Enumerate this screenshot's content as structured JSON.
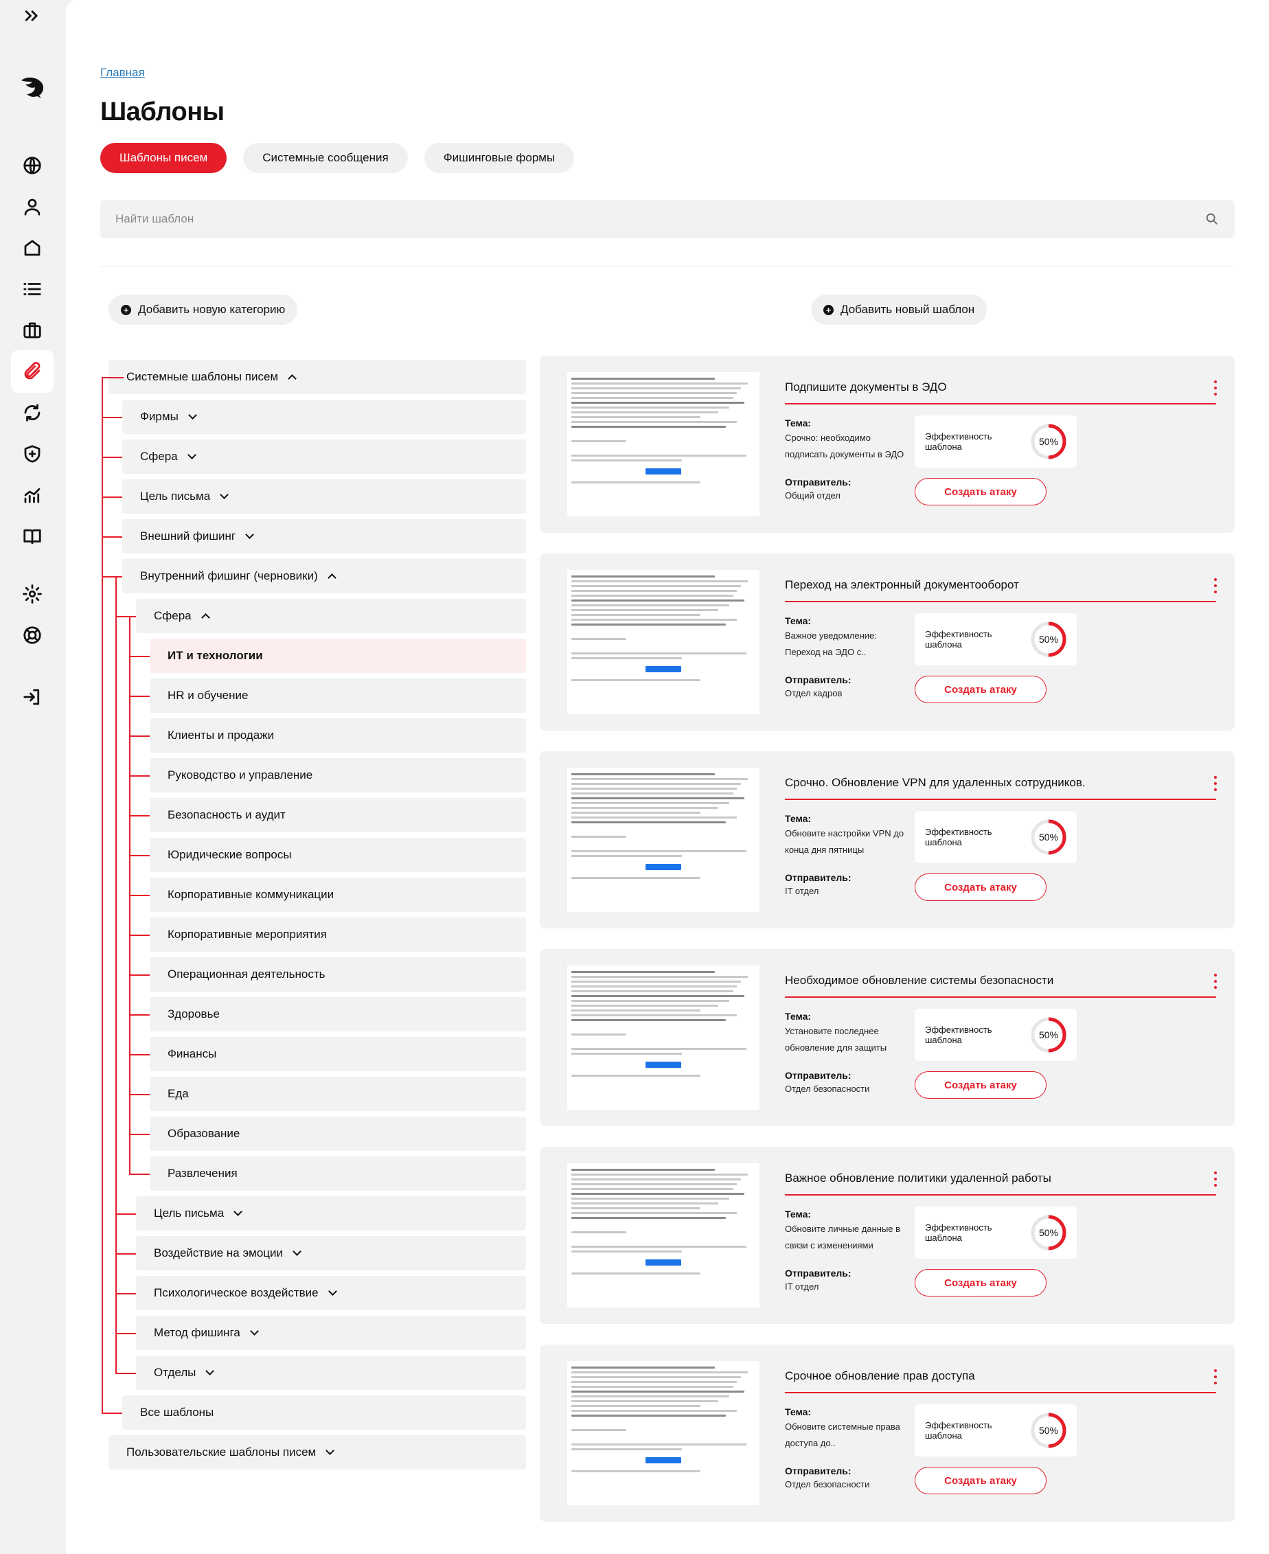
{
  "sidebar": {
    "items": [
      {
        "icon": "expand-icon",
        "active": false
      },
      {
        "icon": "logo-icon",
        "active": false
      },
      {
        "icon": "globe-icon",
        "active": false
      },
      {
        "icon": "user-icon",
        "active": false
      },
      {
        "icon": "home-icon",
        "active": false
      },
      {
        "icon": "list-icon",
        "active": false
      },
      {
        "icon": "briefcase-icon",
        "active": false
      },
      {
        "icon": "paperclip-icon",
        "active": true
      },
      {
        "icon": "refresh-icon",
        "active": false
      },
      {
        "icon": "shield-plus-icon",
        "active": false
      },
      {
        "icon": "analytics-icon",
        "active": false
      },
      {
        "icon": "book-icon",
        "active": false
      },
      {
        "icon": "gear-icon",
        "active": false
      },
      {
        "icon": "lifebuoy-icon",
        "active": false
      },
      {
        "icon": "logout-icon",
        "active": false
      }
    ]
  },
  "breadcrumb": "Главная",
  "title": "Шаблоны",
  "tabs": [
    {
      "label": "Шаблоны писем",
      "active": true
    },
    {
      "label": "Системные сообщения",
      "active": false
    },
    {
      "label": "Фишинговые формы",
      "active": false
    }
  ],
  "search": {
    "placeholder": "Найти шаблон"
  },
  "actions": {
    "add_category": "Добавить новую категорию",
    "add_template": "Добавить новый шаблон"
  },
  "tree": [
    {
      "label": "Системные шаблоны писем",
      "level": 0,
      "chevron": "up"
    },
    {
      "label": "Фирмы",
      "level": 1,
      "chevron": "down"
    },
    {
      "label": "Сфера",
      "level": 1,
      "chevron": "down"
    },
    {
      "label": "Цель письма",
      "level": 1,
      "chevron": "down"
    },
    {
      "label": "Внешний фишинг",
      "level": 1,
      "chevron": "down"
    },
    {
      "label": "Внутренний фишинг (черновики)",
      "level": 1,
      "chevron": "up"
    },
    {
      "label": "Сфера",
      "level": 2,
      "chevron": "up"
    },
    {
      "label": "ИТ и технологии",
      "level": 3,
      "chevron": "",
      "selected": true
    },
    {
      "label": "HR и обучение",
      "level": 3,
      "chevron": ""
    },
    {
      "label": "Клиенты и продажи",
      "level": 3,
      "chevron": ""
    },
    {
      "label": "Руководство и управление",
      "level": 3,
      "chevron": ""
    },
    {
      "label": "Безопасность и аудит",
      "level": 3,
      "chevron": ""
    },
    {
      "label": "Юридические вопросы",
      "level": 3,
      "chevron": ""
    },
    {
      "label": "Корпоративные коммуникации",
      "level": 3,
      "chevron": ""
    },
    {
      "label": "Корпоративные мероприятия",
      "level": 3,
      "chevron": ""
    },
    {
      "label": "Операционная деятельность",
      "level": 3,
      "chevron": ""
    },
    {
      "label": "Здоровье",
      "level": 3,
      "chevron": ""
    },
    {
      "label": "Финансы",
      "level": 3,
      "chevron": ""
    },
    {
      "label": "Еда",
      "level": 3,
      "chevron": ""
    },
    {
      "label": "Образование",
      "level": 3,
      "chevron": ""
    },
    {
      "label": "Развлечения",
      "level": 3,
      "chevron": ""
    },
    {
      "label": "Цель письма",
      "level": 2,
      "chevron": "down"
    },
    {
      "label": "Воздействие на эмоции",
      "level": 2,
      "chevron": "down"
    },
    {
      "label": "Психологическое воздействие",
      "level": 2,
      "chevron": "down"
    },
    {
      "label": "Метод фишинга",
      "level": 2,
      "chevron": "down"
    },
    {
      "label": "Отделы",
      "level": 2,
      "chevron": "down"
    },
    {
      "label": "Все шаблоны",
      "level": 1,
      "chevron": ""
    },
    {
      "label": "Пользовательские шаблоны писем",
      "level": 0,
      "chevron": "down"
    }
  ],
  "card_labels": {
    "subject": "Тема:",
    "sender": "Отправитель:",
    "efficiency": "Эффективность шаблона",
    "attack_button": "Создать атаку"
  },
  "cards": [
    {
      "title": "Подпишите документы в ЭДО",
      "subject": "Срочно: необходимо подписать документы в ЭДО",
      "sender": "Общий отдел",
      "efficiency": "50%",
      "efficiency_value": 0.5
    },
    {
      "title": "Переход на электронный документооборот",
      "subject": "Важное уведомление: Переход на ЭДО с..",
      "sender": "Отдел кадров",
      "efficiency": "50%",
      "efficiency_value": 0.5
    },
    {
      "title": "Срочно. Обновление VPN для удаленных сотрудников.",
      "subject": "Обновите настройки VPN до конца дня пятницы",
      "sender": "IT отдел",
      "efficiency": "50%",
      "efficiency_value": 0.5
    },
    {
      "title": "Необходимое обновление системы безопасности",
      "subject": "Установите последнее обновление для защиты",
      "sender": "Отдел безопасности",
      "efficiency": "50%",
      "efficiency_value": 0.5
    },
    {
      "title": "Важное обновление политики удаленной работы",
      "subject": "Обновите личные данные в связи с изменениями",
      "sender": "IT отдел",
      "efficiency": "50%",
      "efficiency_value": 0.5
    },
    {
      "title": "Срочное обновление прав доступа",
      "subject": "Обновите системные права доступа до..",
      "sender": "Отдел безопасности",
      "efficiency": "50%",
      "efficiency_value": 0.5
    }
  ],
  "colors": {
    "accent": "#e51e2a",
    "panel": "#f2f2f2",
    "link": "#2a7ab8"
  }
}
